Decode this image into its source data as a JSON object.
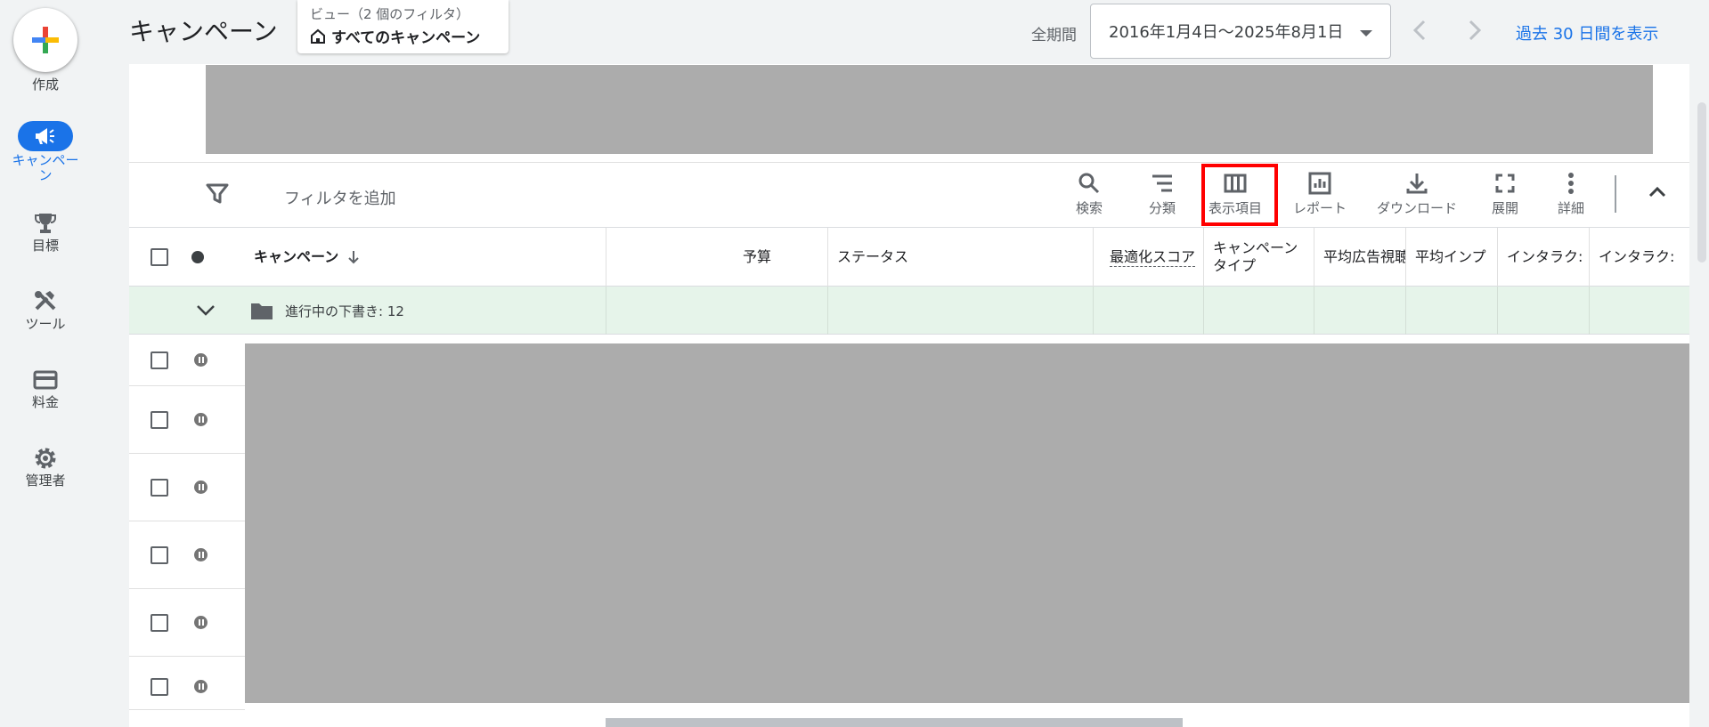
{
  "nav": {
    "create_label": "作成",
    "items": [
      {
        "label": "キャンペーン",
        "icon": "megaphone-icon",
        "active": true
      },
      {
        "label": "目標",
        "icon": "trophy-icon",
        "active": false
      },
      {
        "label": "ツール",
        "icon": "tools-icon",
        "active": false
      },
      {
        "label": "料金",
        "icon": "credit-card-icon",
        "active": false
      },
      {
        "label": "管理者",
        "icon": "gear-icon",
        "active": false
      }
    ]
  },
  "header": {
    "title": "キャンペーン",
    "view_sub": "ビュー（2 個のフィルタ）",
    "view_main": "すべてのキャンペーン",
    "period_label": "全期間",
    "date_range": "2016年1月4日～2025年8月1日",
    "last30_link": "過去 30 日間を表示"
  },
  "toolbar": {
    "filter_placeholder": "フィルタを追加",
    "tools": [
      {
        "label": "検索",
        "icon": "search-icon"
      },
      {
        "label": "分類",
        "icon": "segment-icon"
      },
      {
        "label": "表示項目",
        "icon": "columns-icon",
        "highlighted": true
      },
      {
        "label": "レポート",
        "icon": "report-icon"
      },
      {
        "label": "ダウンロード",
        "icon": "download-icon"
      },
      {
        "label": "展開",
        "icon": "fullscreen-icon"
      },
      {
        "label": "詳細",
        "icon": "more-icon"
      }
    ]
  },
  "table": {
    "columns": {
      "campaign": "キャンペーン",
      "budget": "予算",
      "status": "ステータス",
      "opt_score": "最適化スコア",
      "campaign_type": "キャンペーン\nタイプ",
      "avg_vcpm": "平均広告視聴",
      "avg_cpm": "平均インプ",
      "interactions": "インタラク:",
      "interaction_rate": "インタラク:"
    },
    "group_row": "進行中の下書き: 12"
  },
  "colors": {
    "accent": "#1a73e8",
    "highlight": "#ff0000",
    "group_bg": "#e6f4ea",
    "redacted": "#acacac"
  }
}
